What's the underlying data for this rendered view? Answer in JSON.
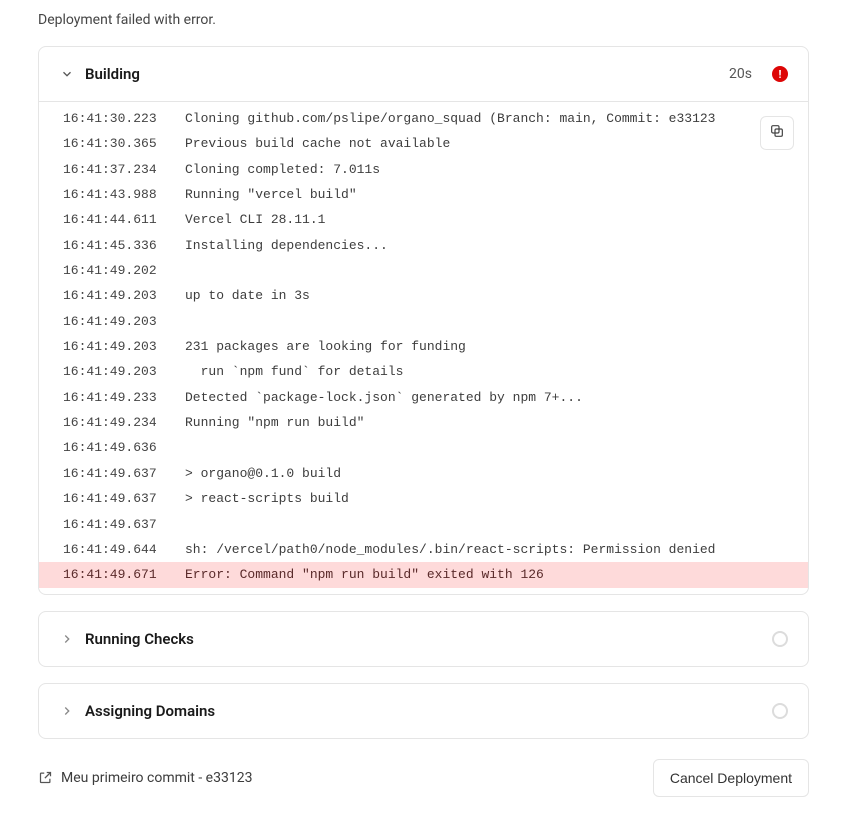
{
  "status_message": "Deployment failed with error.",
  "sections": {
    "building": {
      "title": "Building",
      "duration": "20s",
      "badge_error": "!",
      "lines": [
        {
          "ts": "16:41:30.223",
          "msg": "Cloning github.com/pslipe/organo_squad (Branch: main, Commit: e33123"
        },
        {
          "ts": "16:41:30.365",
          "msg": "Previous build cache not available"
        },
        {
          "ts": "16:41:37.234",
          "msg": "Cloning completed: 7.011s"
        },
        {
          "ts": "16:41:43.988",
          "msg": "Running \"vercel build\""
        },
        {
          "ts": "16:41:44.611",
          "msg": "Vercel CLI 28.11.1"
        },
        {
          "ts": "16:41:45.336",
          "msg": "Installing dependencies..."
        },
        {
          "ts": "16:41:49.202",
          "msg": ""
        },
        {
          "ts": "16:41:49.203",
          "msg": "up to date in 3s"
        },
        {
          "ts": "16:41:49.203",
          "msg": ""
        },
        {
          "ts": "16:41:49.203",
          "msg": "231 packages are looking for funding"
        },
        {
          "ts": "16:41:49.203",
          "msg": "  run `npm fund` for details"
        },
        {
          "ts": "16:41:49.233",
          "msg": "Detected `package-lock.json` generated by npm 7+..."
        },
        {
          "ts": "16:41:49.234",
          "msg": "Running \"npm run build\""
        },
        {
          "ts": "16:41:49.636",
          "msg": ""
        },
        {
          "ts": "16:41:49.637",
          "msg": "> organo@0.1.0 build"
        },
        {
          "ts": "16:41:49.637",
          "msg": "> react-scripts build"
        },
        {
          "ts": "16:41:49.637",
          "msg": ""
        },
        {
          "ts": "16:41:49.644",
          "msg": "sh: /vercel/path0/node_modules/.bin/react-scripts: Permission denied"
        },
        {
          "ts": "16:41:49.671",
          "msg": "Error: Command \"npm run build\" exited with 126",
          "error": true
        }
      ]
    },
    "running_checks": {
      "title": "Running Checks"
    },
    "assigning_domains": {
      "title": "Assigning Domains"
    }
  },
  "footer": {
    "commit_label": "Meu primeiro commit - e33123",
    "cancel_label": "Cancel Deployment"
  }
}
